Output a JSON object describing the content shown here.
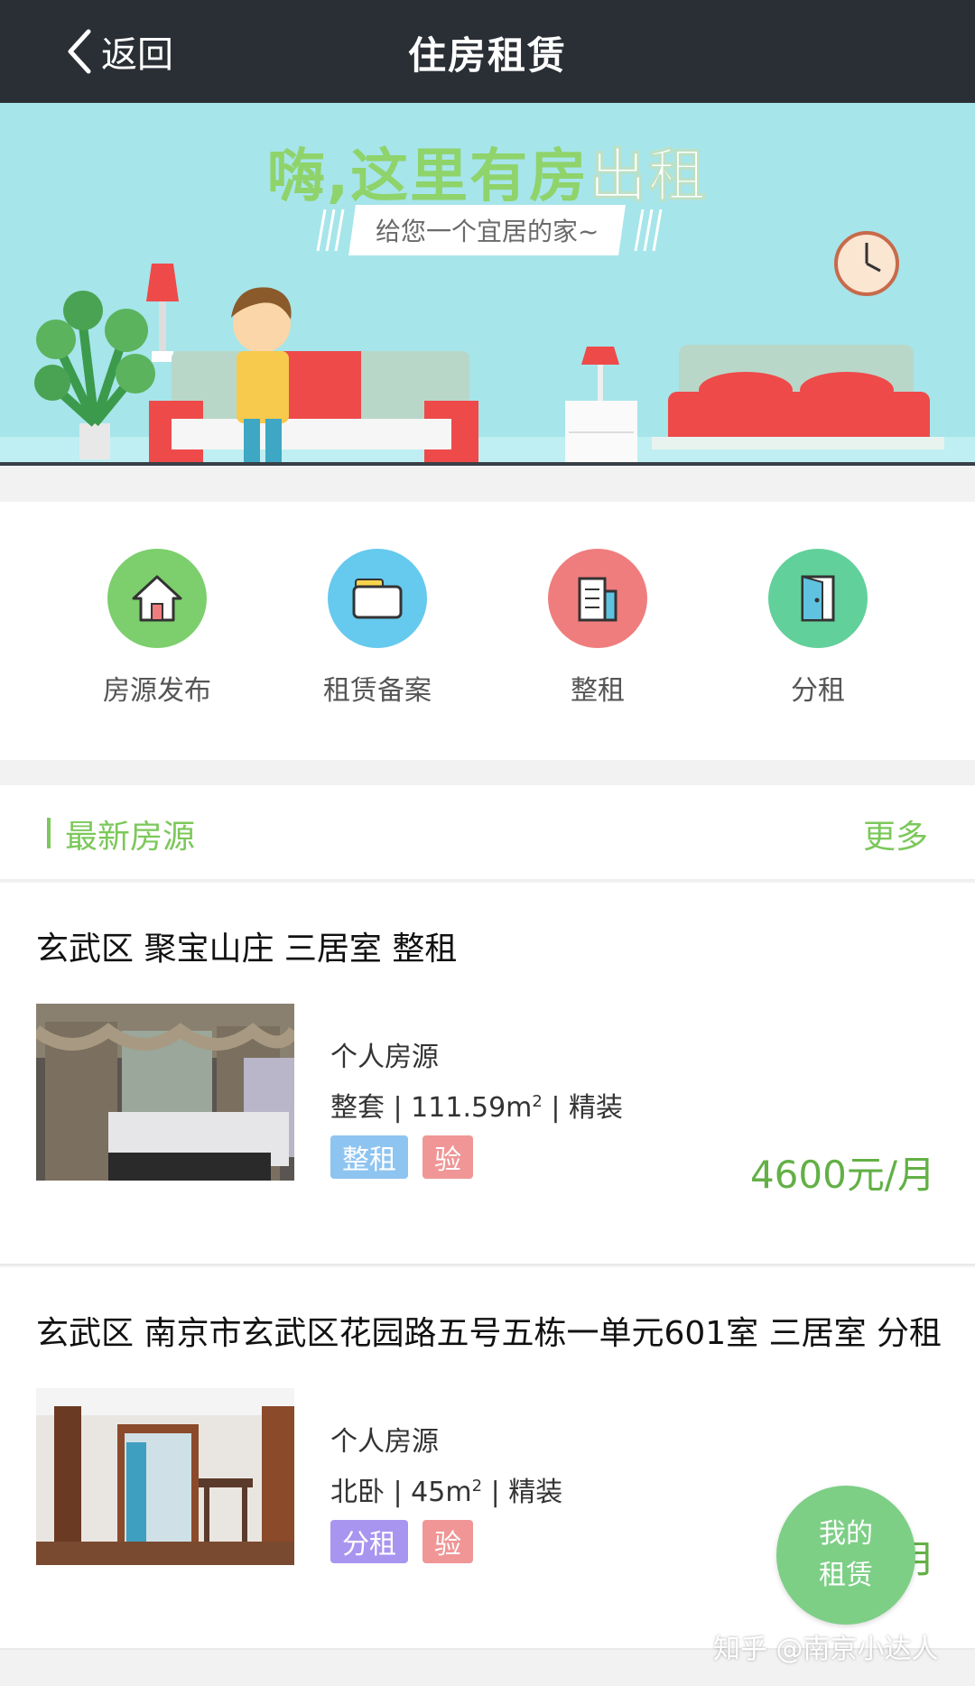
{
  "nav": {
    "back_label": "返回",
    "title": "住房租赁"
  },
  "banner": {
    "headline_part1": "嗨,这里有房",
    "headline_part2": "出租",
    "subtitle": "给您一个宜居的家~"
  },
  "quick_menu": [
    {
      "label": "房源发布",
      "icon": "house-icon",
      "color": "#7ccf6c"
    },
    {
      "label": "租赁备案",
      "icon": "folder-icon",
      "color": "#66c9ee"
    },
    {
      "label": "整租",
      "icon": "building-icon",
      "color": "#ef7d7e"
    },
    {
      "label": "分租",
      "icon": "door-icon",
      "color": "#62d09a"
    }
  ],
  "section": {
    "title": "最新房源",
    "more": "更多"
  },
  "listings": [
    {
      "title": "玄武区 聚宝山庄 三居室 整租",
      "source": "个人房源",
      "spec": "整套 | 111.59m",
      "spec_sup": "2",
      "spec_tail": " | 精装",
      "tag1": "整租",
      "tag2": "验",
      "price": "4600元/月"
    },
    {
      "title": "玄武区 南京市玄武区花园路五号五栋一单元601室 三居室 分租",
      "source": "个人房源",
      "spec": "北卧 | 45m",
      "spec_sup": "2",
      "spec_tail": " | 精装",
      "tag1": "分租",
      "tag2": "验",
      "price_partial": "月"
    }
  ],
  "fab": {
    "line1": "我的",
    "line2": "租赁"
  },
  "watermark": "知乎 @南京小达人",
  "colors": {
    "accent_green": "#7cc85a",
    "nav_bg": "#2a2f36",
    "banner_bg": "#a6e5ea",
    "tag_whole": "#8ec4f0",
    "tag_share": "#a895f0",
    "tag_verified": "#f09696",
    "price": "#63b046"
  }
}
